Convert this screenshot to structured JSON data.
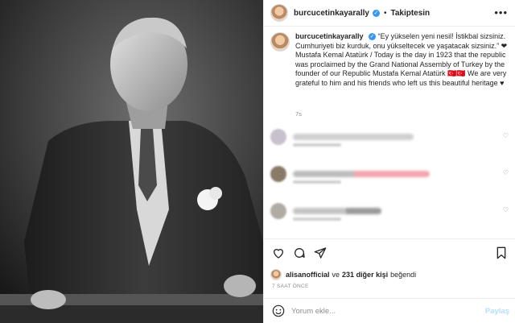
{
  "post": {
    "username": "burcucetinkayarally",
    "follow_label": "Takiptesin",
    "caption": "“Ey yükselen yeni nesil! İstikbal sizsiniz. Cumhuriyeti biz kurduk, onu yükseltecek ve yaşatacak sizsiniz.” ❤ Mustafa Kemal Atatürk / Today is the day in 1923 that the republic was proclaimed by the Grand National Assembly of Turkey by the founder of our Republic Mustafa Kemal Atatürk 🇹🇷🇹🇷 We are very grateful to him and his friends who left us this beautiful heritage ♥",
    "caption_time": "7s",
    "liked_by_user": "alisanofficial",
    "likes_mid": "ve",
    "likes_others": "231 diğer kişi",
    "likes_suffix": "beğendi",
    "time_ago": "7 SAAT ÖNCE",
    "comment_placeholder": "Yorum ekle...",
    "share_label": "Paylaş"
  },
  "icons": {
    "verified": "verified-badge",
    "more": "more-options-icon",
    "like": "heart-icon",
    "comment": "comment-icon",
    "share": "send-icon",
    "save": "bookmark-icon",
    "emoji": "emoji-icon"
  },
  "colors": {
    "accent": "#3897f0",
    "share_disabled": "#b2dffc",
    "muted": "#8e8e8e"
  }
}
